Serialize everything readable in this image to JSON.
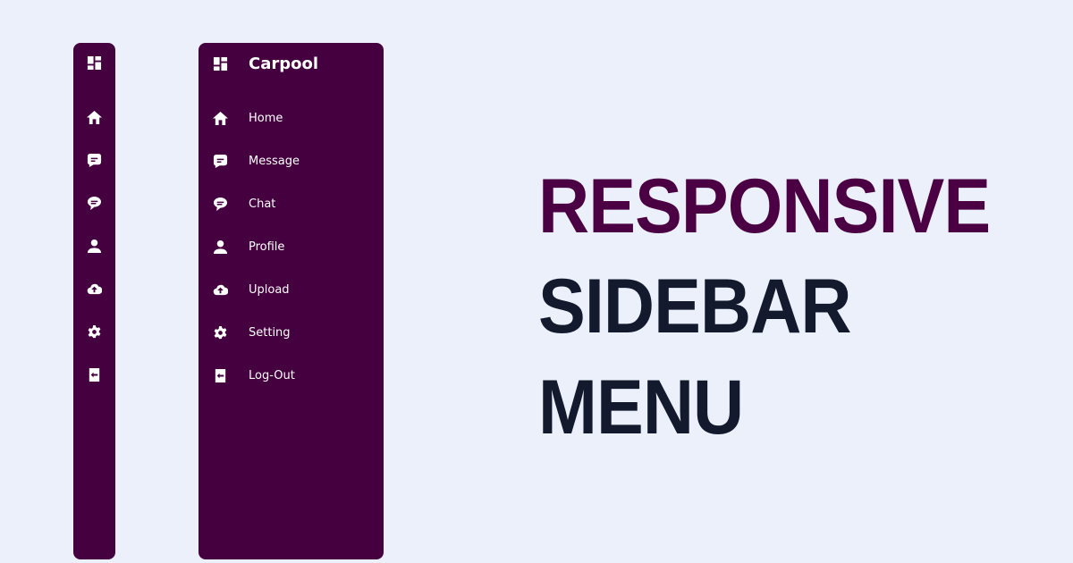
{
  "colors": {
    "background": "#ecf0fb",
    "sidebar": "#45003f",
    "accent": "#4a0042",
    "dark": "#131a2e"
  },
  "sidebar": {
    "brand": "Carpool",
    "brand_icon": "dashboard-icon",
    "items": [
      {
        "label": "Home",
        "icon": "home-icon"
      },
      {
        "label": "Message",
        "icon": "message-icon"
      },
      {
        "label": "Chat",
        "icon": "chat-icon"
      },
      {
        "label": "Profile",
        "icon": "profile-icon"
      },
      {
        "label": "Upload",
        "icon": "upload-icon"
      },
      {
        "label": "Setting",
        "icon": "gear-icon"
      },
      {
        "label": "Log-Out",
        "icon": "logout-icon"
      }
    ]
  },
  "headline": {
    "line1": "RESPONSIVE",
    "line2": "SIDEBAR",
    "line3": "MENU"
  }
}
